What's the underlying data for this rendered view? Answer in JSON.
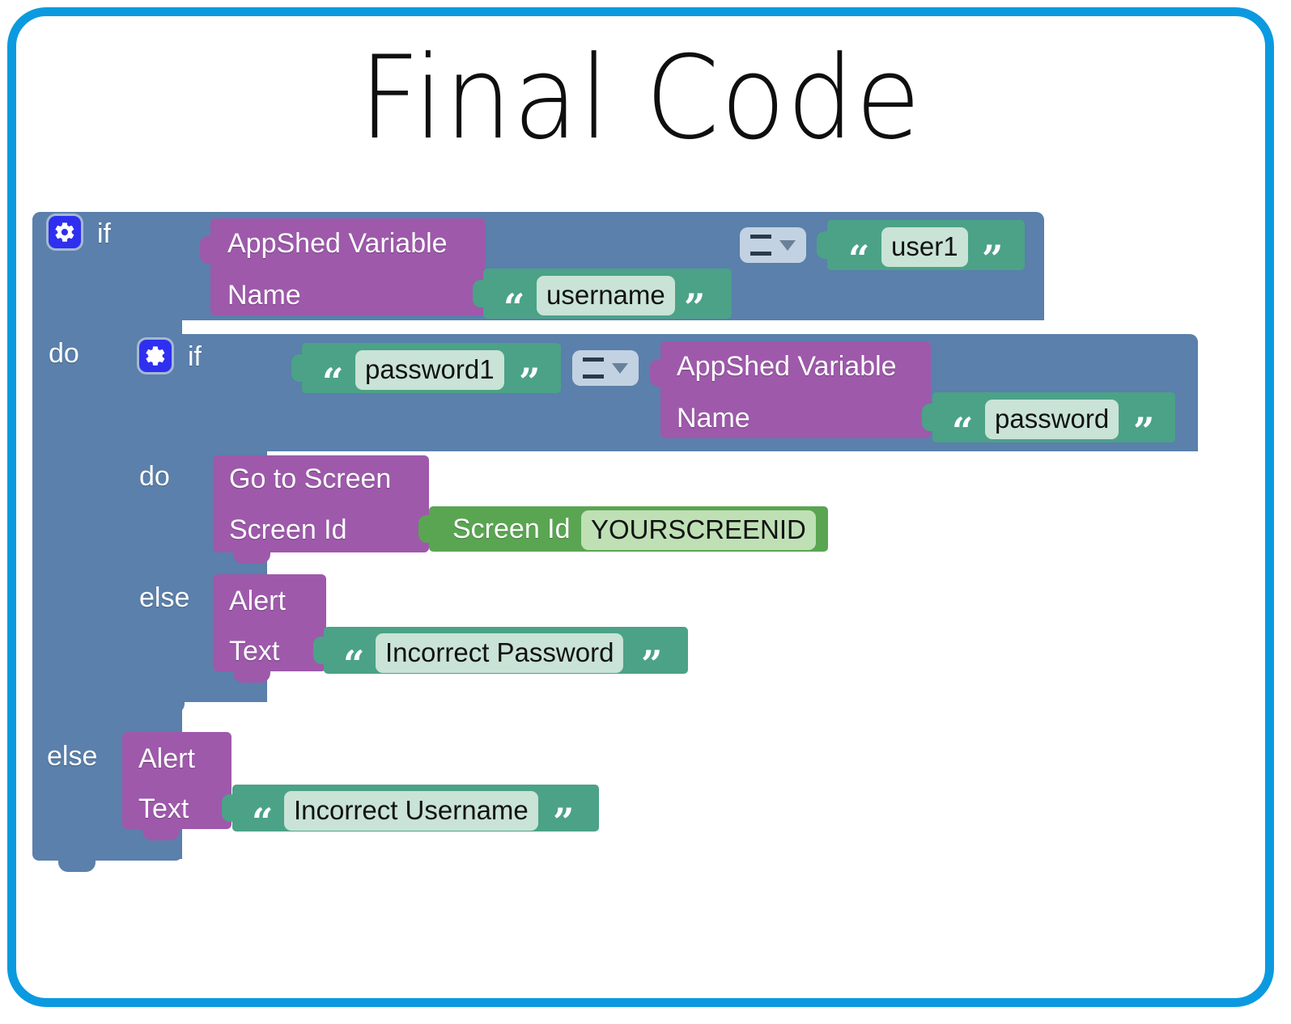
{
  "page": {
    "title": "Final Code",
    "border_color": "#0b9ae0",
    "background": "#ffffff"
  },
  "colors": {
    "control_blue": "#5a80ab",
    "variable_purple": "#9e59ab",
    "text_teal": "#4ba287",
    "screen_green": "#5aa552",
    "dropdown_blue": "#c3d2e2",
    "field_light": "#c9e3d6",
    "gear_blue": "#2f2ff0"
  },
  "program": {
    "outer_if": {
      "gear_icon": "gear-icon",
      "if_label": "if",
      "condition": {
        "left": {
          "block_label": "AppShed Variable",
          "param_label": "Name",
          "param_value": "username",
          "quote_open": "“",
          "quote_close": "”"
        },
        "operator": "=",
        "operator_dropdown_icon": "chevron-down-icon",
        "right": {
          "value": "user1",
          "quote_open": "“",
          "quote_close": "”"
        }
      },
      "do_label": "do",
      "else_label": "else",
      "inner_if": {
        "gear_icon": "gear-icon",
        "if_label": "if",
        "condition": {
          "left": {
            "value": "password1",
            "quote_open": "“",
            "quote_close": "”"
          },
          "operator": "=",
          "operator_dropdown_icon": "chevron-down-icon",
          "right": {
            "block_label": "AppShed Variable",
            "param_label": "Name",
            "param_value": "password",
            "quote_open": "“",
            "quote_close": "”"
          }
        },
        "do_label": "do",
        "do_body": {
          "block_label": "Go to Screen",
          "param_label": "Screen Id",
          "value_block_label": "Screen Id",
          "value": "YOURSCREENID"
        },
        "else_label": "else",
        "else_body": {
          "block_label": "Alert",
          "param_label": "Text",
          "value": "Incorrect Password",
          "quote_open": "“",
          "quote_close": "”"
        }
      },
      "else_body": {
        "block_label": "Alert",
        "param_label": "Text",
        "value": "Incorrect Username",
        "quote_open": "“",
        "quote_close": "”"
      }
    }
  }
}
